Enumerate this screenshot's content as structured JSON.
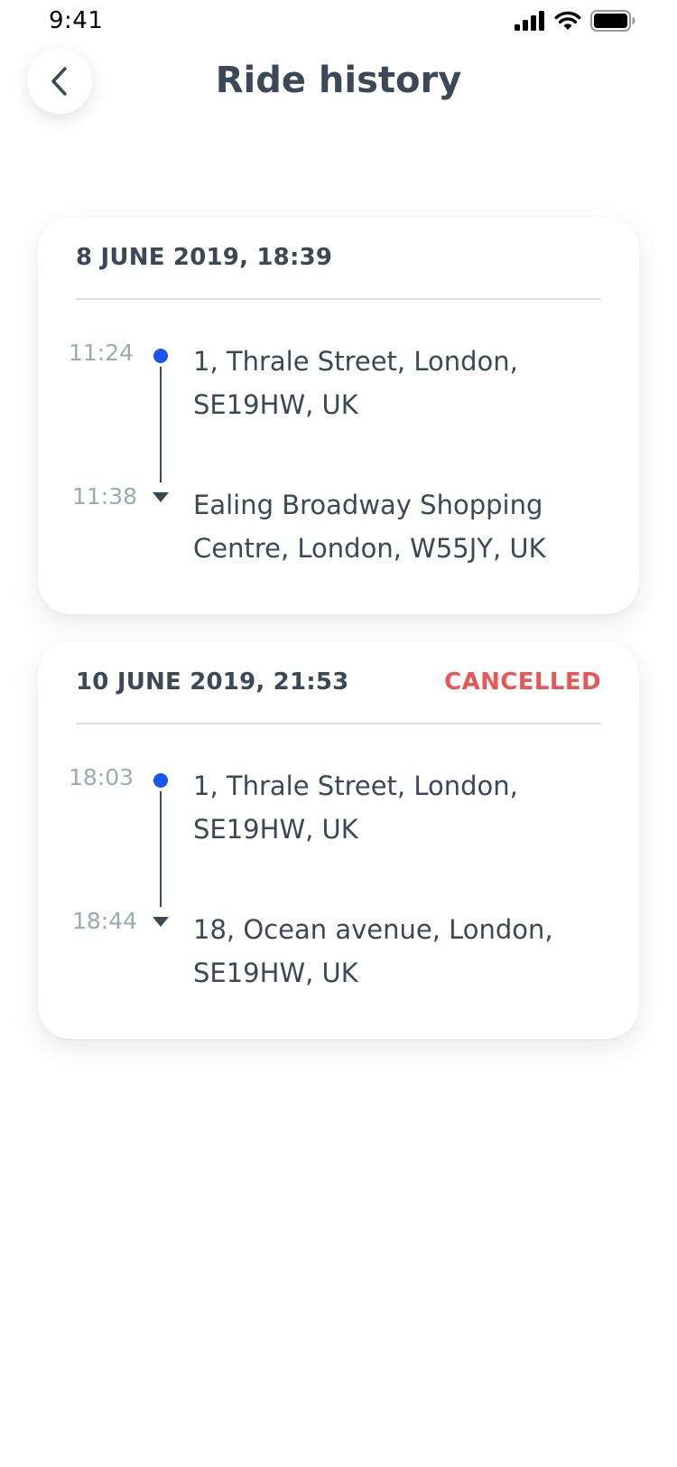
{
  "status_bar": {
    "time": "9:41",
    "icons": [
      "cellular-signal-icon",
      "wifi-icon",
      "battery-icon"
    ]
  },
  "header": {
    "back_icon": "chevron-left-icon",
    "title": "Ride history"
  },
  "colors": {
    "text_primary": "#3d4856",
    "text_muted": "#9aabb5",
    "accent_blue": "#1a56ec",
    "status_cancelled": "#e85656",
    "divider": "#d9e1e3"
  },
  "rides": [
    {
      "date": "8 JUNE 2019, 18:39",
      "status": "",
      "pickup": {
        "time": "11:24",
        "address": "1, Thrale Street, London, SE19HW, UK"
      },
      "dropoff": {
        "time": "11:38",
        "address": "Ealing Broadway Shopping Centre, London, W55JY, UK"
      }
    },
    {
      "date": "10 JUNE 2019, 21:53",
      "status": "CANCELLED",
      "pickup": {
        "time": "18:03",
        "address": "1, Thrale Street, London, SE19HW, UK"
      },
      "dropoff": {
        "time": "18:44",
        "address": "18, Ocean avenue, London, SE19HW, UK"
      }
    }
  ]
}
